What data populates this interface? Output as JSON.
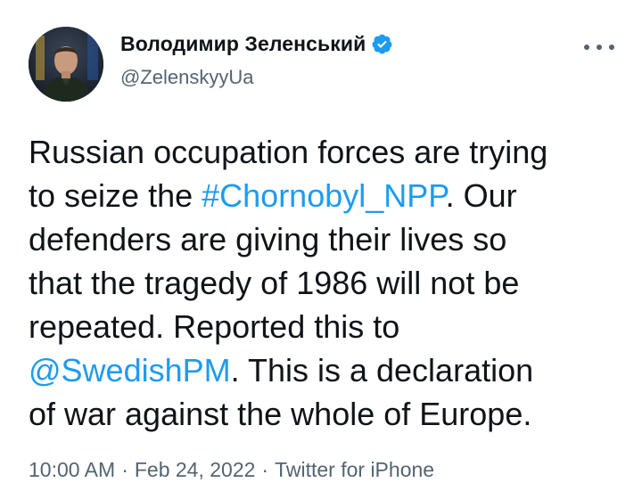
{
  "author": {
    "display_name": "Володимир Зеленський",
    "handle": "@ZelenskyyUa",
    "verified": true,
    "avatar_icon": "profile-photo"
  },
  "menu": {
    "icon": "more-horizontal-icon"
  },
  "tweet": {
    "lines": [
      {
        "segments": [
          {
            "text": "Russian occupation forces are trying",
            "kind": "text"
          }
        ]
      },
      {
        "segments": [
          {
            "text": "to seize the ",
            "kind": "text"
          },
          {
            "text": "#Chornobyl_NPP",
            "kind": "hashtag"
          },
          {
            "text": ". Our",
            "kind": "text"
          }
        ]
      },
      {
        "segments": [
          {
            "text": "defenders are giving their lives so",
            "kind": "text"
          }
        ]
      },
      {
        "segments": [
          {
            "text": "that the tragedy of 1986 will not be",
            "kind": "text"
          }
        ]
      },
      {
        "segments": [
          {
            "text": "repeated. Reported this to",
            "kind": "text"
          }
        ]
      },
      {
        "segments": [
          {
            "text": "@SwedishPM",
            "kind": "mention"
          },
          {
            "text": ". This is a declaration",
            "kind": "text"
          }
        ]
      },
      {
        "segments": [
          {
            "text": "of war against the whole of Europe.",
            "kind": "text"
          }
        ]
      }
    ]
  },
  "meta": {
    "time": "10:00 AM",
    "date": "Feb 24, 2022",
    "source": "Twitter for iPhone",
    "separator": "·"
  },
  "colors": {
    "text": "#0f1419",
    "secondary": "#536471",
    "accent": "#1d9bf0"
  }
}
